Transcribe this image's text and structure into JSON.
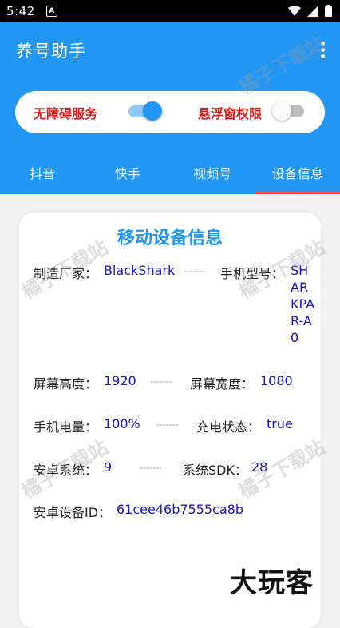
{
  "status_bar": {
    "time": "5:42",
    "notification_letter": "A"
  },
  "app_bar": {
    "title": "养号助手"
  },
  "toggles": {
    "accessibility": {
      "label": "无障碍服务",
      "on": true
    },
    "overlay": {
      "label": "悬浮窗权限",
      "on": false
    }
  },
  "tabs": [
    {
      "label": "抖音",
      "active": false
    },
    {
      "label": "快手",
      "active": false
    },
    {
      "label": "视频号",
      "active": false
    },
    {
      "label": "设备信息",
      "active": true
    }
  ],
  "device_info": {
    "title": "移动设备信息",
    "separator": "-------",
    "manufacturer_label": "制造厂家：",
    "manufacturer": "BlackShark",
    "model_label": "手机型号：",
    "model": "SHARKPAR-A0",
    "screen_height_label": "屏幕高度：",
    "screen_height": "1920",
    "screen_width_label": "屏幕宽度：",
    "screen_width": "1080",
    "battery_label": "手机电量：",
    "battery": "100%",
    "charging_label": "充电状态：",
    "charging": "true",
    "android_label": "安卓系统：",
    "android": "9",
    "sdk_label": "系统SDK：",
    "sdk": "28",
    "device_id_label": "安卓设备ID：",
    "device_id": "61cee46b7555ca8b"
  },
  "watermark": "橘子下载站",
  "brand": "大玩客",
  "colors": {
    "primary": "#2196f3",
    "danger": "#e01b1b",
    "value": "#1a12cc",
    "tab_indicator": "#ff4d4f"
  }
}
